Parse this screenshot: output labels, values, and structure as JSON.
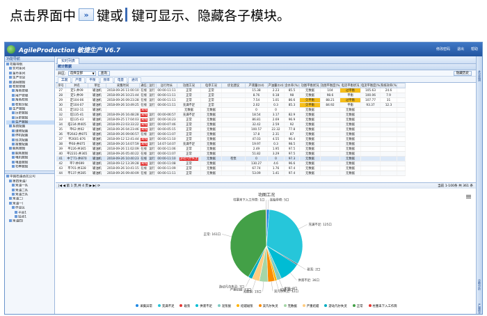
{
  "caption": {
    "before": "点击界面中",
    "after_icon": "键或",
    "after_bar": "键可显示、隐藏各子模块。",
    "icon_glyph": "»"
  },
  "app": {
    "title": "AgileProduction 敏捷生产 V6.7",
    "top_links": [
      "修改密码",
      "退出",
      "帮助"
    ]
  },
  "sidebar": {
    "header": "功能导航",
    "items": [
      {
        "label": "功能导航",
        "indent": 0
      },
      {
        "label": "实时系列",
        "indent": 1
      },
      {
        "label": "金币系列",
        "indent": 1
      },
      {
        "label": "生产信息",
        "indent": 1
      },
      {
        "label": "通用数据",
        "indent": 1
      },
      {
        "label": "权限管理",
        "indent": 1
      },
      {
        "label": "角色管理",
        "indent": 2
      },
      {
        "label": "用户管理",
        "indent": 2
      },
      {
        "label": "角色权限",
        "indent": 2
      },
      {
        "label": "权限分配",
        "indent": 2
      },
      {
        "label": "生产数据",
        "indent": 1
      },
      {
        "label": "历史数据",
        "indent": 2
      },
      {
        "label": "历史数据",
        "indent": 2
      },
      {
        "label": "生产数据",
        "indent": 2,
        "selected": true
      },
      {
        "label": "系统配置",
        "indent": 1
      },
      {
        "label": "维修配置",
        "indent": 2
      },
      {
        "label": "停机配置",
        "indent": 2
      },
      {
        "label": "班次配置",
        "indent": 2
      },
      {
        "label": "报警配置",
        "indent": 2
      },
      {
        "label": "能耗数据",
        "indent": 1
      },
      {
        "label": "能耗数据",
        "indent": 2
      },
      {
        "label": "电机数据",
        "indent": 2
      },
      {
        "label": "电量数据",
        "indent": 2
      },
      {
        "label": "功率数据",
        "indent": 2
      }
    ],
    "org_tree": [
      {
        "label": "中国石油西北公司",
        "indent": 0
      },
      {
        "label": "第四采油厂",
        "indent": 1
      },
      {
        "label": "采油一队",
        "indent": 2
      },
      {
        "label": "采油二队",
        "indent": 2
      },
      {
        "label": "采油三队",
        "indent": 2
      },
      {
        "label": "采油二厂",
        "indent": 1
      },
      {
        "label": "采油一厂",
        "indent": 1
      },
      {
        "label": "作业区",
        "indent": 2
      },
      {
        "label": "平台1",
        "indent": 3
      },
      {
        "label": "站点1",
        "indent": 3
      },
      {
        "label": "采油四厂",
        "indent": 1
      }
    ]
  },
  "tab": "实时列表",
  "panel_title": "统计数据",
  "filter": {
    "label": "井区:",
    "select_value": "选择全部",
    "query": "查询",
    "right_button": "隐藏历史"
  },
  "subtabs": [
    "工况",
    "产量",
    "平衡",
    "频率",
    "电量",
    "通讯"
  ],
  "right_strip": [
    "井况监测",
    "诊断分析",
    "产量统计"
  ],
  "table": {
    "columns": [
      "序号",
      "井名",
      "单位",
      "采集时间",
      "通信",
      "运行",
      "运行时长",
      "功图工况",
      "电参工况",
      "优化建议",
      "产液量(t/d)",
      "产油量(t/d)",
      "含水率(%)",
      "功图平衡状况",
      "功图平衡度(%)",
      "电流平衡状况",
      "电流平衡度(%)",
      "系统效率(%)",
      ""
    ],
    "rows": [
      [
        "27",
        "定1-井09",
        "输油机",
        "2018-09-26 11:00:10",
        "在线",
        "运行",
        "00:00-11:11",
        "正常",
        "正常",
        "",
        "15.38",
        "2.23",
        "85.5",
        "无数据",
        "104",
        "过平衡",
        "105.63",
        "24.6",
        ""
      ],
      [
        "28",
        "定1-井09",
        "输油机",
        "2018-09-26 10:21:44",
        "在线",
        "运行",
        "00:00-11:11",
        "正常",
        "正常",
        "",
        "8.76",
        "0.18",
        "98",
        "无数据",
        "98.6",
        "平衡",
        "100.06",
        "7.9",
        ""
      ],
      [
        "29",
        "定104-06",
        "输油机",
        "2018-09-26 09:23:28",
        "在线",
        "运行",
        "00:00-11:11",
        "正常",
        "正常",
        "",
        "7.54",
        "1.01",
        "86.6",
        "欠平衡",
        "88.21",
        "过平衡",
        "107.77",
        "31",
        ""
      ],
      [
        "30",
        "定104-07",
        "输油机",
        "2018-09-26 10:49:25",
        "在线",
        "运行",
        "00:00-11:11",
        "充满不足",
        "正常",
        "",
        "2.02",
        "0.3",
        "85.3",
        "欠平衡",
        "84.92",
        "平衡",
        "93.37",
        "12.3",
        ""
      ],
      [
        "31",
        "定102-11",
        "输油机",
        "",
        "离线",
        "",
        "",
        "无数据",
        "无数据",
        "",
        "0",
        "0",
        "",
        "无数据",
        "",
        "无数据",
        "",
        "",
        ""
      ],
      [
        "32",
        "塔135-41",
        "输油机",
        "2018-09-26 16:48:28",
        "离线",
        "运行",
        "00:00-06:57",
        "充满不足",
        "无数据",
        "",
        "18.54",
        "3.17",
        "82.9",
        "无数据",
        "",
        "无数据",
        "",
        "",
        ""
      ],
      [
        "33",
        "塔135-43",
        "输油机",
        "2018-09-25 17:04:03",
        "离线",
        "运行",
        "00:00-16:23",
        "正常",
        "无数据",
        "",
        "86.81",
        "2.69",
        "96.9",
        "无数据",
        "",
        "无数据",
        "",
        "",
        ""
      ],
      [
        "34",
        "塔234-井405",
        "输油机",
        "2018-09-23 03:33:22",
        "离线",
        "运行",
        "00:00-07:46",
        "正常",
        "无数据",
        "",
        "32.42",
        "2.59",
        "92",
        "无数据",
        "",
        "无数据",
        "",
        "",
        ""
      ],
      [
        "35",
        "平62-井02",
        "输油机",
        "2018-09-26 04:23:46",
        "离线",
        "运行",
        "00:00-05:15",
        "正常",
        "无数据",
        "",
        "100.57",
        "22.32",
        "77.8",
        "无数据",
        "",
        "无数据",
        "",
        "",
        ""
      ],
      [
        "36",
        "平2642-井875",
        "输油机",
        "2018-09-26 09:06:57",
        "在线",
        "运行",
        "00:00-11:07",
        "正常",
        "无数据",
        "",
        "17.8",
        "2.31",
        "87",
        "无数据",
        "",
        "无数据",
        "",
        "",
        ""
      ],
      [
        "37",
        "平2601-876",
        "输油机",
        "2018-09-12 12:41:44",
        "离线",
        "运行",
        "00:00-11:10",
        "正常",
        "无数据",
        "",
        "47.03",
        "4.55",
        "90.4",
        "无数据",
        "",
        "无数据",
        "",
        "",
        ""
      ],
      [
        "38",
        "平60-井875",
        "输油机",
        "2018-09-20 14:07:59",
        "离线",
        "运行",
        "14:07-14:07",
        "充满不足",
        "无数据",
        "",
        "19.97",
        "0.3",
        "98.5",
        "无数据",
        "",
        "无数据",
        "",
        "",
        ""
      ],
      [
        "39",
        "平226-井365",
        "输油机",
        "2018-09-26 11:02:09",
        "在线",
        "运行",
        "00:00-11:06",
        "正常",
        "无数据",
        "",
        "2.49",
        "1.95",
        "97.5",
        "无数据",
        "",
        "无数据",
        "",
        "",
        ""
      ],
      [
        "40",
        "平2231-井365",
        "输油机",
        "2018-09-26 05:40:22",
        "在线",
        "运行",
        "00:00-11:07",
        "正常",
        "无数据",
        "",
        "51.82",
        "3.29",
        "97.5",
        "无数据",
        "",
        "无数据",
        "",
        "",
        ""
      ],
      [
        "41",
        "中了71-井870",
        "输油机",
        "2018-09-26 10:40:23",
        "在线",
        "运行",
        "00:00-11:10",
        "游动凡尔失灵",
        "无数据",
        "检泵",
        "0",
        "0",
        "97.3",
        "无数据",
        "",
        "无数据",
        "",
        "",
        ""
      ],
      [
        "42",
        "平7-井699",
        "输油机",
        "2018-09-12 13:39:28",
        "离线",
        "运行",
        "00:00-11:08",
        "正常",
        "无数据",
        "",
        "130.27",
        "4.6",
        "96.6",
        "无数据",
        "",
        "无数据",
        "",
        "",
        ""
      ],
      [
        "43",
        "平701-井328",
        "输油机",
        "2018-09-26 10:41:15",
        "在线",
        "运行",
        "00:00-11:09",
        "正常",
        "无数据",
        "",
        "67.74",
        "1.76",
        "97.4",
        "无数据",
        "",
        "无数据",
        "",
        "",
        ""
      ],
      [
        "44",
        "平137-井285",
        "输油机",
        "2018-09-26 09:40:09",
        "在线",
        "运行",
        "00:00-11:11",
        "正常",
        "无数据",
        "",
        "53.09",
        "1.41",
        "97.4",
        "无数据",
        "",
        "无数据",
        "",
        "",
        ""
      ]
    ]
  },
  "pager": {
    "text": "第 1 页,共 4 页",
    "info": "当前 1-100条 共 361 条"
  },
  "chart_data": {
    "type": "pie",
    "title": "功图工况",
    "slices": [
      {
        "name": "连抽带喷",
        "value": 5,
        "color": "#1e88e5"
      },
      {
        "name": "充满不足",
        "value": 125,
        "color": "#26c6da"
      },
      {
        "name": "碰泵",
        "value": 2,
        "color": "#455a64"
      },
      {
        "name": "供液不足",
        "value": 36,
        "color": "#00bcd4"
      },
      {
        "name": "泵脱",
        "value": 8,
        "color": "#80cbc4"
      },
      {
        "name": "结蜡",
        "value": 4,
        "color": "#ffb300"
      },
      {
        "name": "双凡尔失灵",
        "value": 12,
        "color": "#fb8c00"
      },
      {
        "name": "无数据",
        "value": 15,
        "color": "#a5d6a7"
      },
      {
        "name": "严重结蜡",
        "value": 13,
        "color": "#ffcc80"
      },
      {
        "name": "游动凡尔失灵",
        "value": 7,
        "color": "#00acc1"
      },
      {
        "name": "正常",
        "value": 161,
        "color": "#43a047"
      },
      {
        "name": "柱塞未下入工作筒",
        "value": 1,
        "color": "#e53935"
      }
    ],
    "labels": [
      {
        "text": "连抽带喷: 5口",
        "slice": 0
      },
      {
        "text": "柱塞未下入工作筒: 1口",
        "slice": 11
      },
      {
        "text": "充满不足: 125口",
        "slice": 1
      },
      {
        "text": "碰泵: 2口",
        "slice": 2
      },
      {
        "text": "供液不足: 36口",
        "slice": 3
      },
      {
        "text": "泵脱: 8口",
        "slice": 4
      },
      {
        "text": "结蜡: 4口",
        "slice": 5
      },
      {
        "text": "双凡尔失灵: 12口",
        "slice": 6
      },
      {
        "text": "无数据: 15口",
        "slice": 7
      },
      {
        "text": "严重结蜡: 13口",
        "slice": 8
      },
      {
        "text": "游动凡尔失灵: 7口",
        "slice": 9
      },
      {
        "text": "正常: 161口",
        "slice": 10
      }
    ],
    "legend": [
      "采集异常",
      "充满不足",
      "碰泵",
      "供液不足",
      "泥泵脱",
      "结蜡碰泵",
      "双凡尔失灵",
      "无数据",
      "严重结蜡",
      "游动凡尔失灵",
      "正常",
      "柱塞未下入工作筒"
    ],
    "legend_colors": [
      "#1e88e5",
      "#26c6da",
      "#e53935",
      "#00bcd4",
      "#80cbc4",
      "#ffb300",
      "#fb8c00",
      "#a5d6a7",
      "#ffcc80",
      "#00acc1",
      "#43a047",
      "#e53935"
    ]
  }
}
